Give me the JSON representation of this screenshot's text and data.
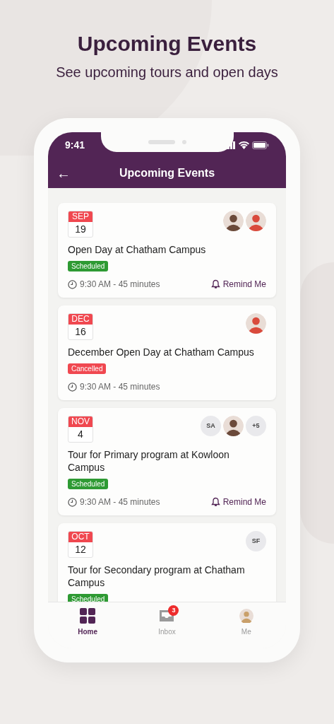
{
  "promo": {
    "title": "Upcoming Events",
    "subtitle": "See upcoming tours and open days"
  },
  "status_bar": {
    "time": "9:41"
  },
  "header": {
    "back": "←",
    "title": "Upcoming Events"
  },
  "events": [
    {
      "month": "SEP",
      "day": "19",
      "title": "Open Day at Chatham Campus",
      "status": {
        "kind": "scheduled",
        "label": "Scheduled"
      },
      "time": "9:30 AM - 45 minutes",
      "remind": "Remind Me",
      "attendees": [
        {
          "kind": "photo",
          "color": "#6b4a3a"
        },
        {
          "kind": "photo",
          "color": "#d94a3c"
        }
      ]
    },
    {
      "month": "DEC",
      "day": "16",
      "title": "December Open Day at Chatham Campus",
      "status": {
        "kind": "cancelled",
        "label": "Cancelled"
      },
      "time": "9:30 AM - 45 minutes",
      "attendees": [
        {
          "kind": "photo",
          "color": "#d94a3c"
        }
      ]
    },
    {
      "month": "NOV",
      "day": "4",
      "title": "Tour for Primary program at Kowloon Campus",
      "status": {
        "kind": "scheduled",
        "label": "Scheduled"
      },
      "time": "9:30 AM - 45 minutes",
      "remind": "Remind Me",
      "attendees": [
        {
          "kind": "initials",
          "text": "SA"
        },
        {
          "kind": "photo",
          "color": "#6b4a3a"
        },
        {
          "kind": "more",
          "text": "+5"
        }
      ]
    },
    {
      "month": "OCT",
      "day": "12",
      "title": "Tour for Secondary program at Chatham Campus",
      "status": {
        "kind": "scheduled",
        "label": "Scheduled"
      },
      "attendees": [
        {
          "kind": "initials",
          "text": "SF"
        }
      ]
    }
  ],
  "tab_bar": [
    {
      "kind": "home",
      "label": "Home",
      "selected": true
    },
    {
      "kind": "inbox",
      "label": "Inbox",
      "selected": false,
      "badge": "3"
    },
    {
      "kind": "me",
      "label": "Me",
      "selected": false
    }
  ]
}
